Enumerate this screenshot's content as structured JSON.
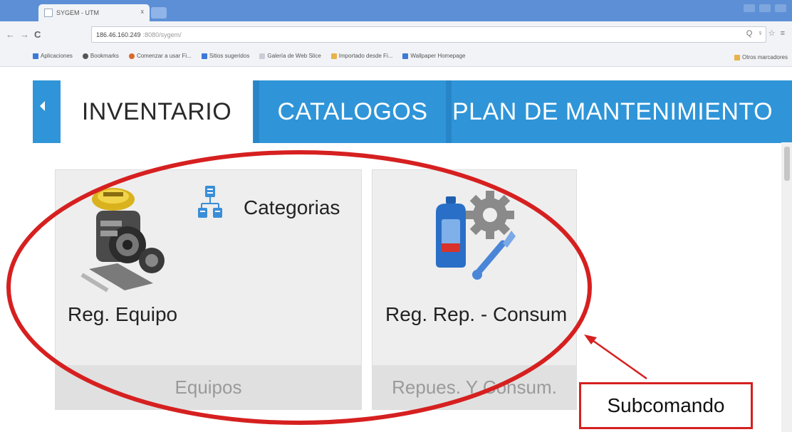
{
  "browser": {
    "tab_title": "SYGEM - UTM",
    "tab_close": "x",
    "url_host": "186.46.160.249",
    "url_path": ":8080/sygem/",
    "nav_back": "←",
    "nav_forward": "→",
    "nav_reload": "C",
    "toolbar_icons": "Q ♀ ☆ ≡",
    "bookmarks": [
      "Aplicaciones",
      "Bookmarks",
      "Comenzar a usar Fi...",
      "Sitios sugeridos",
      "Galería de Web Slice",
      "Importado desde Fi...",
      "Wallpaper Homepage"
    ],
    "other_bookmarks": "Otros marcadores"
  },
  "app": {
    "tabs": [
      "INVENTARIO",
      "CATALOGOS",
      "PLAN DE MANTENIMIENTO"
    ],
    "active_tab": "INVENTARIO",
    "tiles": [
      {
        "label": "Reg. Equipo",
        "sub": "Categorias",
        "footer": "Equipos"
      },
      {
        "label": "Reg. Rep. - Consum",
        "footer": "Repues. Y Consum."
      }
    ],
    "accent_color": "#2f95d8"
  },
  "annotation": {
    "callout": "Subcomando",
    "color": "#d62020"
  }
}
